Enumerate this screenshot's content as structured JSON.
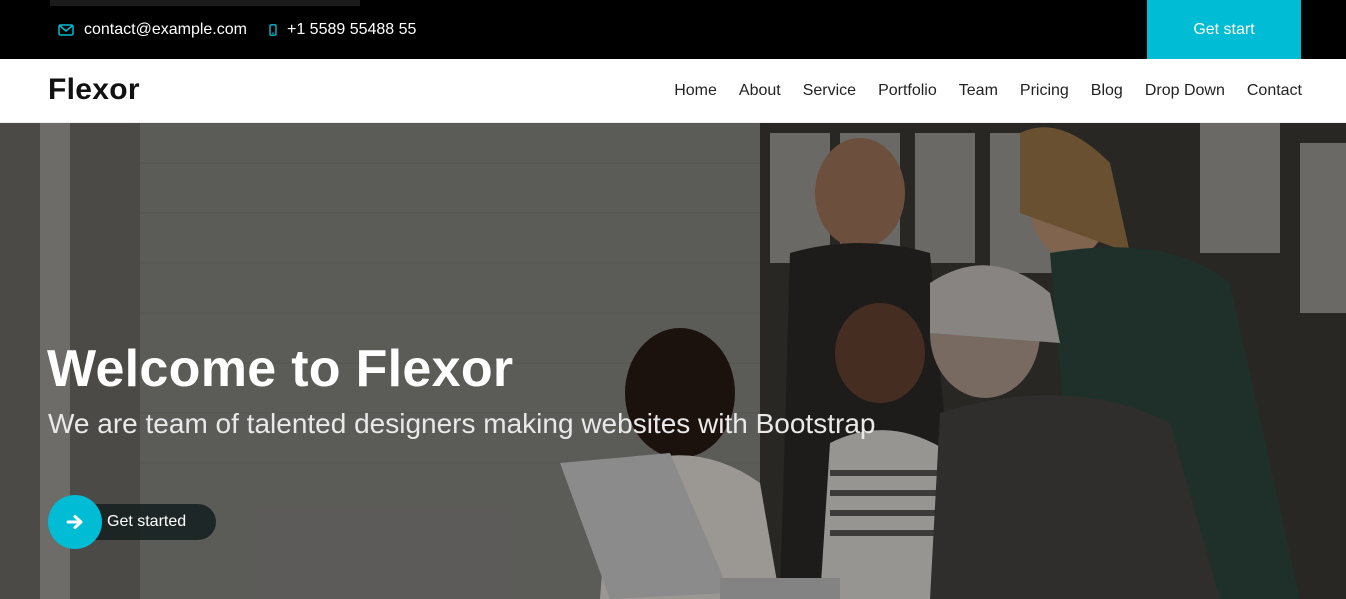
{
  "topbar": {
    "email": "contact@example.com",
    "phone": "+1 5589 55488 55",
    "cta_label": "Get start",
    "email_icon": "envelope-icon",
    "phone_icon": "phone-icon"
  },
  "header": {
    "logo": "Flexor",
    "nav": [
      {
        "label": "Home"
      },
      {
        "label": "About"
      },
      {
        "label": "Service"
      },
      {
        "label": "Portfolio"
      },
      {
        "label": "Team"
      },
      {
        "label": "Pricing"
      },
      {
        "label": "Blog"
      },
      {
        "label": "Drop Down"
      },
      {
        "label": "Contact"
      }
    ]
  },
  "hero": {
    "title": "Welcome to Flexor",
    "subtitle": "We are team of talented designers making websites with Bootstrap",
    "cta_label": "Get started",
    "cta_icon": "arrow-right-icon"
  },
  "colors": {
    "accent": "#00bcd4",
    "topbar_bg": "#000000",
    "header_bg": "#ffffff"
  }
}
